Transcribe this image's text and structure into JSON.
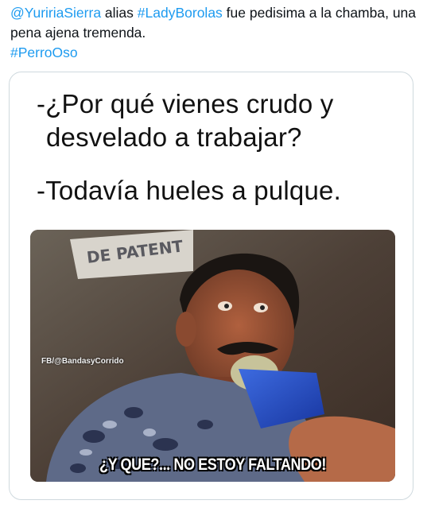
{
  "tweet": {
    "mention": "@YuririaSierra",
    "text_1": " alias ",
    "hashtag_1": "#LadyBorolas",
    "text_2": "  fue pedisima a la chamba, una pena ajena tremenda.",
    "hashtag_2": "#PerroOso"
  },
  "meme": {
    "line_1": "-¿Por qué vienes crudo y",
    "line_2": "desvelado a trabajar?",
    "line_3": "-Todavía hueles a pulque.",
    "sign_text": "DE PATENT",
    "watermark": "FB/@BandasyCorrido",
    "caption": "¿Y QUE?... NO ESTOY FALTANDO!"
  },
  "colors": {
    "link": "#1d9bf0",
    "text": "#0f1419",
    "border": "#cfd9de"
  }
}
